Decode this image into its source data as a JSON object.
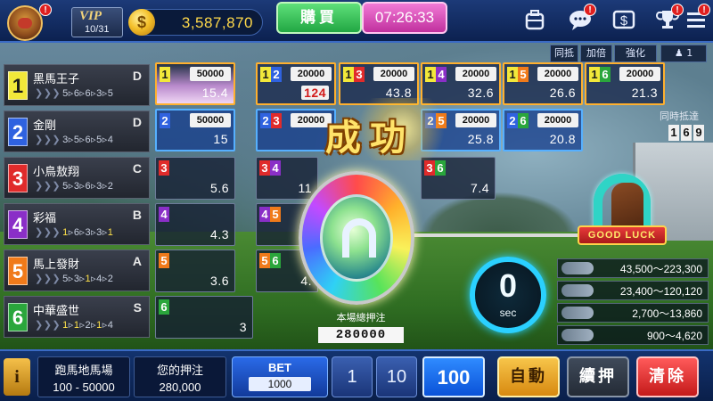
{
  "top_bar": {
    "vip_label": "VIP",
    "vip_level": "10/31",
    "coins_symbol": "$",
    "coins": "3,587,870",
    "buy_label": "購買",
    "time": "07:26:33",
    "alert_marker": "!",
    "icons": [
      "backpack-icon",
      "chat-icon",
      "cash-icon",
      "trophy-icon",
      "menu-icon"
    ]
  },
  "options": {
    "same_odds": "同抵",
    "double": "加倍",
    "enhance": "強化",
    "user_count": "1"
  },
  "horses": [
    {
      "num": "1",
      "name": "黑馬王子",
      "grade": "D",
      "form": [
        "5",
        "6",
        "6",
        "3",
        "5"
      ],
      "color": "#f2e83a"
    },
    {
      "num": "2",
      "name": "金剛",
      "grade": "D",
      "form": [
        "3",
        "5",
        "6",
        "5",
        "4"
      ],
      "color": "#2f62e0"
    },
    {
      "num": "3",
      "name": "小鳥敖翔",
      "grade": "C",
      "form": [
        "5",
        "3",
        "6",
        "3",
        "2"
      ],
      "color": "#e02b2b"
    },
    {
      "num": "4",
      "name": "彩福",
      "grade": "B",
      "form": [
        "1",
        "6",
        "3",
        "3",
        "1"
      ],
      "color": "#8a2fc7"
    },
    {
      "num": "5",
      "name": "馬上發財",
      "grade": "A",
      "form": [
        "5",
        "3",
        "1",
        "4",
        "2"
      ],
      "color": "#f07a1a"
    },
    {
      "num": "6",
      "name": "中華盛世",
      "grade": "S",
      "form": [
        "1",
        "1",
        "2",
        "1",
        "4"
      ],
      "color": "#2aa63c"
    }
  ],
  "cells": {
    "r1": [
      {
        "key": [
          "1"
        ],
        "limit": "50000",
        "odds": "15.4"
      },
      {
        "key": [
          "1",
          "2"
        ],
        "limit": "20000",
        "odds": "124"
      },
      {
        "key": [
          "1",
          "3"
        ],
        "limit": "20000",
        "odds": "43.8"
      },
      {
        "key": [
          "1",
          "4"
        ],
        "limit": "20000",
        "odds": "32.6"
      },
      {
        "key": [
          "1",
          "5"
        ],
        "limit": "20000",
        "odds": "26.6"
      },
      {
        "key": [
          "1",
          "6"
        ],
        "limit": "20000",
        "odds": "21.3"
      }
    ],
    "r2": [
      {
        "key": [
          "2"
        ],
        "limit": "50000",
        "odds": "15"
      },
      {
        "key": [
          "2",
          "3"
        ],
        "limit": "20000",
        "odds": ""
      },
      {
        "key": [
          "2",
          "5"
        ],
        "limit": "20000",
        "odds": "25.8"
      },
      {
        "key": [
          "2",
          "6"
        ],
        "limit": "20000",
        "odds": "20.8"
      }
    ],
    "r3": [
      {
        "key": [
          "3"
        ],
        "odds": "5.6"
      },
      {
        "key": [
          "3",
          "4"
        ],
        "odds": "11"
      },
      {
        "key": [
          "3",
          "6"
        ],
        "odds": "7.4"
      }
    ],
    "r4": [
      {
        "key": [
          "4"
        ],
        "odds": "4.3"
      },
      {
        "key": [
          "4",
          "5"
        ],
        "odds": ""
      }
    ],
    "r5": [
      {
        "key": [
          "5"
        ],
        "odds": "3.6"
      },
      {
        "key": [
          "5",
          "6"
        ],
        "odds": "4."
      }
    ],
    "r6": [
      {
        "key": [
          "6"
        ],
        "odds": "3"
      }
    ]
  },
  "success_text": "成功",
  "pool": {
    "label": "本場總押注",
    "value": "280000"
  },
  "sync": {
    "label": "同時抵達",
    "digits": [
      "1",
      "6",
      "9"
    ]
  },
  "good_luck": "GOOD LUCK",
  "countdown": {
    "value": "0",
    "unit": "sec"
  },
  "payouts": [
    "43,500～223,300",
    "23,400～120,120",
    "2,700～13,860",
    "900～4,620"
  ],
  "bottom": {
    "info": "i",
    "venue_title": "跑馬地馬場",
    "venue_range": "100 - 50000",
    "your_bet_title": "您的押注",
    "your_bet_value": "280,000",
    "bet_title": "BET",
    "bet_value": "1000",
    "chips": [
      "1",
      "10",
      "100"
    ],
    "auto": "自動",
    "repeat": "續押",
    "clear": "清除"
  },
  "colors": {
    "accent_gold": "#ffd94a",
    "buy_green": "#21a743",
    "timer_pink": "#c0309e",
    "countdown_cyan": "#2ad0ff"
  }
}
